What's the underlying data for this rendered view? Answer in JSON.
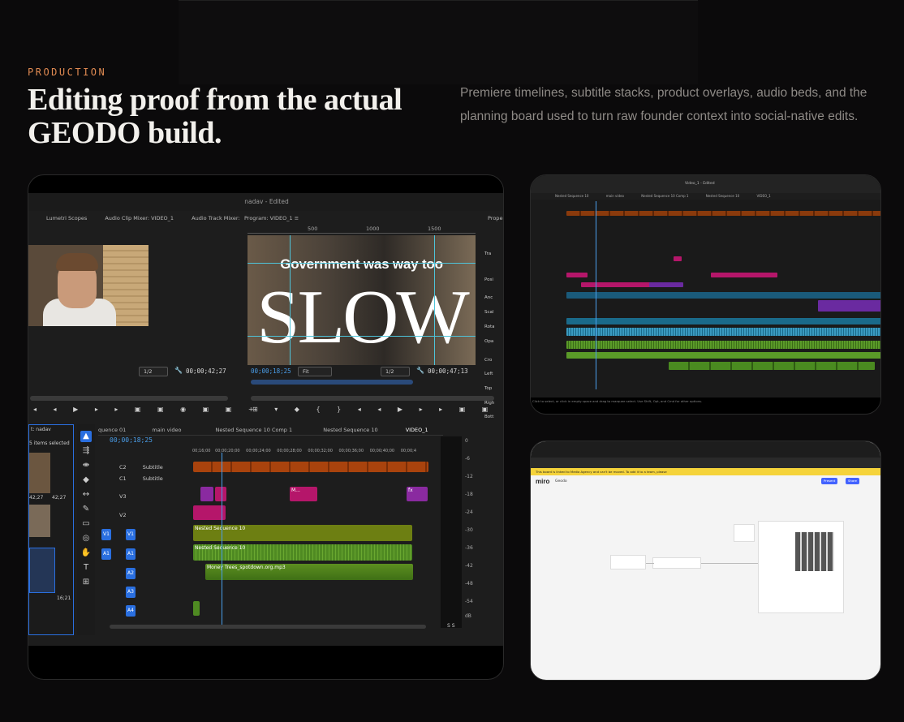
{
  "section": {
    "eyebrow": "PRODUCTION",
    "headline": "Editing proof from the actual GEODO build.",
    "intro": "Premiere timelines, subtitle stacks, product overlays, audio beds, and the planning board used to turn raw founder context into social-native edits."
  },
  "premiere": {
    "window_title": "nadav - Edited",
    "source_tabs": [
      "Lumetri Scopes",
      "Audio Clip Mixer: VIDEO_1",
      "Audio Track Mixer: VII"
    ],
    "program_tab": "Program: VIDEO_1",
    "properties_tab": "Propert",
    "ruler_labels": [
      "500",
      "1000",
      "1500"
    ],
    "source_zoom": "1/2",
    "source_timecode": "00;00;42;27",
    "program_timecode_in": "00;00;18;25",
    "program_fit": "Fit",
    "program_zoom": "1/2",
    "program_timecode_out": "00;00;47;13",
    "caption_line": "Government was way too",
    "caption_big": "SLOW",
    "properties_rows": [
      "Tra",
      "Posi",
      "Anc",
      "Scal",
      "Rota",
      "Opa",
      "Cro",
      "Left",
      "Top",
      "Righ",
      "Bott"
    ],
    "project": {
      "tab": "t: nadav",
      "items_selected": "5 items selected",
      "thumb_duration_1": "42;27",
      "thumb_duration_2": "42;27",
      "thumb_duration_3": "16;21"
    },
    "sequence_tabs": [
      "quence 01",
      "main video",
      "Nested Sequence 10 Comp 1",
      "Nested Sequence 10",
      "VIDEO_1"
    ],
    "timeline_timecode": "00;00;18;25",
    "time_ticks": [
      "00;16;00",
      "00;00;20;00",
      "00;00;24;00",
      "00;00;28;00",
      "00;00;32;00",
      "00;00;36;00",
      "00;00;40;00",
      "00;00;4"
    ],
    "tracks": [
      {
        "id": "C2",
        "name": "Subtitle"
      },
      {
        "id": "C1",
        "name": "Subtitle"
      },
      {
        "id": "V3",
        "name": ""
      },
      {
        "id": "V2",
        "name": ""
      },
      {
        "id": "V1",
        "name": "V1"
      },
      {
        "id": "A1",
        "name": "A1"
      },
      {
        "id": "A2",
        "name": "A2"
      },
      {
        "id": "A3",
        "name": "A3"
      },
      {
        "id": "A4",
        "name": "A4"
      }
    ],
    "clips": {
      "nested_v": "Nested Sequence 10",
      "nested_a": "Nested Sequence 10",
      "music": "Money Trees_spotdown.org.mp3",
      "fx": "fx",
      "v3_marker": "M..."
    },
    "meter_scale": [
      "0",
      "-6",
      "-12",
      "-18",
      "-24",
      "-30",
      "-36",
      "-42",
      "-48",
      "-54",
      "dB"
    ],
    "meter_solo": "S S"
  },
  "timeline_shot": {
    "footer": "Click to select, or click in empty space and drag to marquee select. Use Shift, Opt, and Cmd for other options.",
    "tabs": [
      "Nested Sequence 10",
      "main video",
      "Nested Sequence 10 Comp 1",
      "Nested Sequence 10",
      "VIDEO_1"
    ],
    "title": "Video_1 - Edited"
  },
  "miro_shot": {
    "logo": "miro",
    "board": "Geodo",
    "banner": "This board is linked to Media Agency and can't be moved. To add it to a team, please",
    "share": "Share",
    "present": "Present"
  },
  "colors": {
    "accent": "#e08a52",
    "premiere_blue": "#2a6fe0",
    "playhead": "#4a9eea",
    "subtitle_clip": "#a9430d",
    "video_green": "#6d7f12",
    "audio_green": "#4f8a22",
    "magenta_clip": "#b5166a"
  }
}
